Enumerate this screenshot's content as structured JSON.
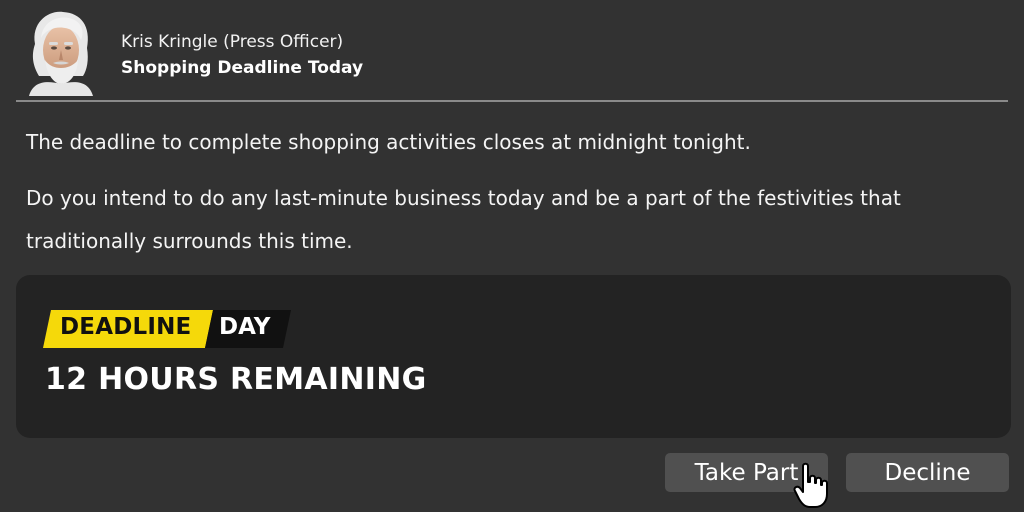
{
  "header": {
    "sender": "Kris Kringle (Press Officer)",
    "subject": "Shopping Deadline Today",
    "avatar_icon": "person-avatar-icon"
  },
  "message": {
    "line1": "The deadline to complete shopping activities closes at midnight tonight.",
    "line2": "Do you intend to do any last-minute business today and be a part of the festivities that",
    "line3": "traditionally surrounds this time."
  },
  "panel": {
    "badge_left": "DEADLINE",
    "badge_right": "DAY",
    "remaining": "12 HOURS REMAINING",
    "badge_color": "#f5d90a"
  },
  "actions": {
    "take_part": "Take Part",
    "decline": "Decline"
  },
  "cursor": {
    "icon": "hand-pointer-icon"
  }
}
